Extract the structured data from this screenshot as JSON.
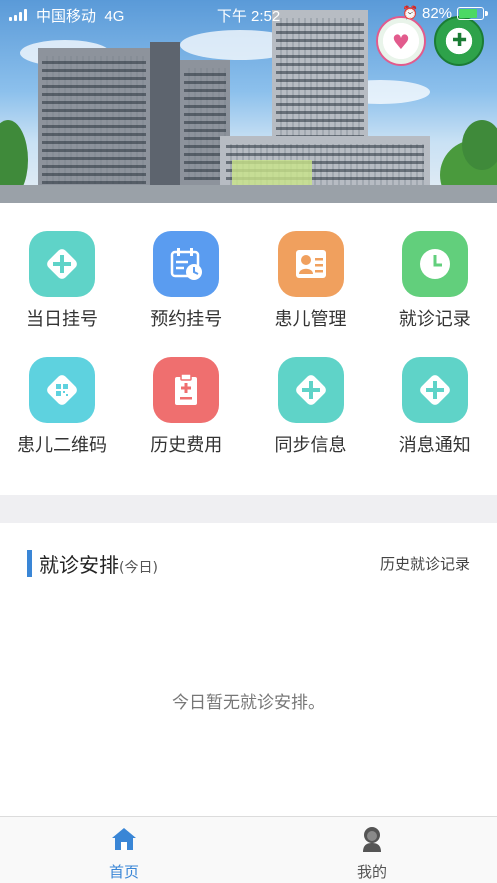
{
  "status_bar": {
    "carrier": "中国移动",
    "network": "4G",
    "time": "下午 2:52",
    "battery_percent": "82%",
    "battery_level": 0.82
  },
  "banner": {
    "logo_left_name": "hospital-logo",
    "logo_right_name": "health-logo"
  },
  "grid": [
    {
      "label": "当日挂号",
      "icon": "plus-diamond-icon",
      "color": "#5fd3c8"
    },
    {
      "label": "预约挂号",
      "icon": "calendar-clock-icon",
      "color": "#5a9cf0"
    },
    {
      "label": "患儿管理",
      "icon": "id-card-icon",
      "color": "#f0a05e"
    },
    {
      "label": "就诊记录",
      "icon": "clock-icon",
      "color": "#62cf7c"
    },
    {
      "label": "患儿二维码",
      "icon": "qr-code-icon",
      "color": "#5ed2df"
    },
    {
      "label": "历史费用",
      "icon": "clipboard-icon",
      "color": "#ef6f6f"
    },
    {
      "label": "同步信息",
      "icon": "plus-diamond-icon",
      "color": "#5fd3c8"
    },
    {
      "label": "消息通知",
      "icon": "plus-diamond-icon",
      "color": "#5fd3c8"
    }
  ],
  "schedule": {
    "title": "就诊安排",
    "subtitle": "(今日)",
    "history_link": "历史就诊记录",
    "empty_text": "今日暂无就诊安排。"
  },
  "tabbar": [
    {
      "label": "首页",
      "icon": "home-icon",
      "active": true,
      "color": "#3a86d6"
    },
    {
      "label": "我的",
      "icon": "user-icon",
      "active": false,
      "color": "#555555"
    }
  ]
}
